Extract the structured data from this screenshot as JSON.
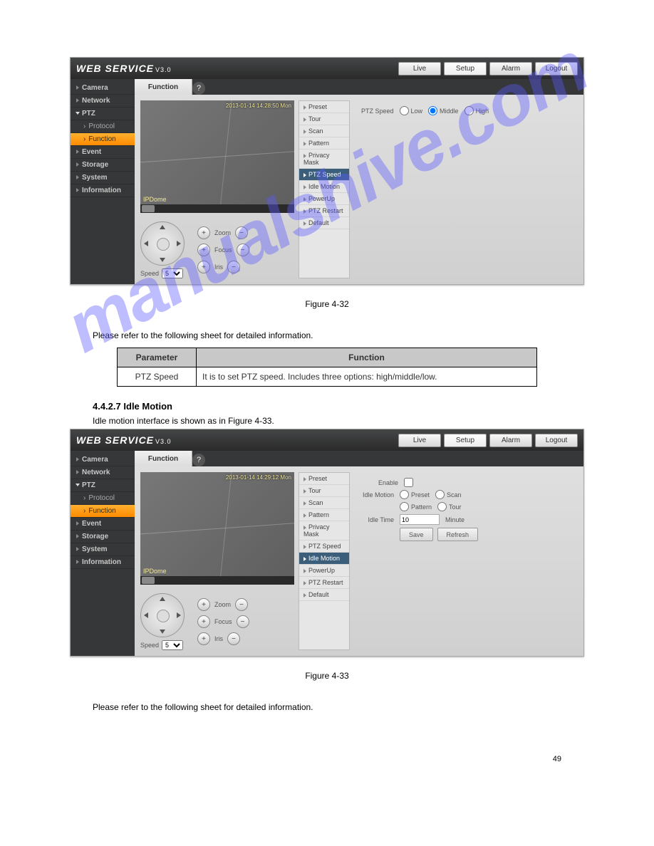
{
  "brand": {
    "name": "WEB  SERVICE",
    "version": "V3.0"
  },
  "topnav": {
    "live": "Live",
    "setup": "Setup",
    "alarm": "Alarm",
    "logout": "Logout"
  },
  "sidebar": {
    "camera": "Camera",
    "network": "Network",
    "ptz": "PTZ",
    "protocol": "Protocol",
    "function": "Function",
    "event": "Event",
    "storage": "Storage",
    "system": "System",
    "information": "Information"
  },
  "tab": {
    "function": "Function"
  },
  "help": "?",
  "video": {
    "ts1": "2013-01-14 14:28:50 Mon",
    "ts2": "2013-01-14 14:29:12 Mon",
    "label": "IPDome"
  },
  "ptz": {
    "speed_label": "Speed",
    "speed_value": "5",
    "zoom": "Zoom",
    "focus": "Focus",
    "iris": "Iris",
    "plus": "+",
    "minus": "−"
  },
  "funclist": {
    "preset": "Preset",
    "tour": "Tour",
    "scan": "Scan",
    "pattern": "Pattern",
    "privacy": "Privacy Mask",
    "ptzspeed": "PTZ Speed",
    "idle": "Idle Motion",
    "powerup": "PowerUp",
    "restart": "PTZ Restart",
    "default": "Default"
  },
  "panel1": {
    "label": "PTZ Speed",
    "low": "Low",
    "middle": "Middle",
    "high": "High"
  },
  "panel2": {
    "enable": "Enable",
    "idle_motion": "Idle Motion",
    "preset": "Preset",
    "scan": "Scan",
    "pattern": "Pattern",
    "tour": "Tour",
    "idle_time": "Idle Time",
    "idle_value": "10",
    "minute": "Minute",
    "save": "Save",
    "refresh": "Refresh"
  },
  "caption1": "Figure 4-32",
  "body1": "Please refer to the following sheet for detailed information.",
  "table": {
    "h1": "Parameter",
    "h2": "Function",
    "r1c1": "PTZ Speed",
    "r1c2": "It is to set PTZ speed. Includes three options: high/middle/low."
  },
  "sec_idle": {
    "num": "4.4.2.7",
    "title": "Idle Motion",
    "body": "Idle motion interface is shown as in Figure 4-33."
  },
  "caption2": "Figure 4-33",
  "body2": "Please refer to the following sheet for detailed information.",
  "foot": "49"
}
